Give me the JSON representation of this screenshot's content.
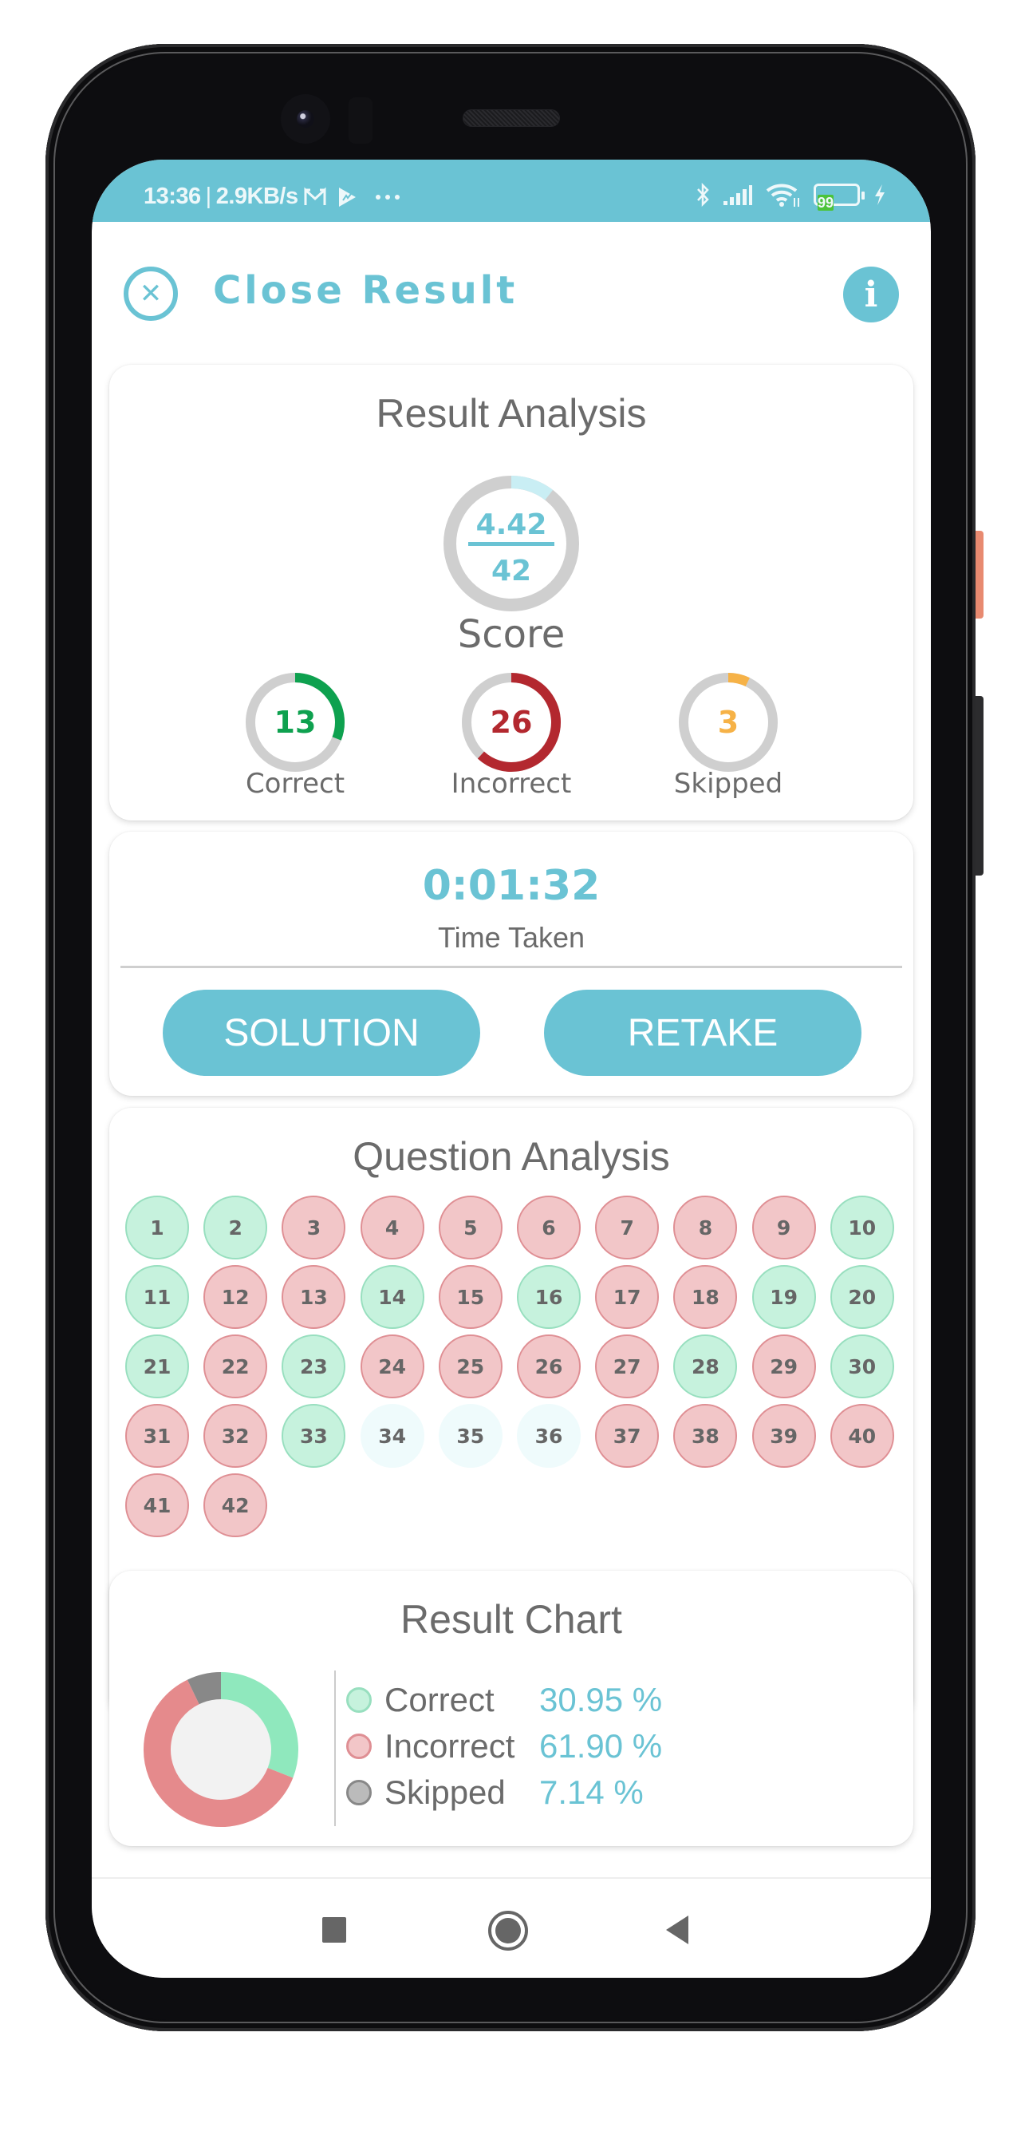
{
  "status_bar": {
    "time": "13:36",
    "separator": "|",
    "network_speed": "2.9KB/s",
    "battery_level": "99",
    "icons": [
      "gmail-icon",
      "play-icon",
      "more-dots-icon",
      "bluetooth-icon",
      "signal-icon",
      "wifi-icon",
      "battery-icon",
      "charging-icon"
    ]
  },
  "header": {
    "close_icon": "close-circle-icon",
    "title": "Close Result",
    "info_icon": "info-icon"
  },
  "colors": {
    "accent": "#6ac3d4",
    "correct": "#0ea14f",
    "incorrect": "#b3282f",
    "skipped": "#f6b247",
    "ring_track": "#cfcfcf",
    "score_arc": "#c9eef4",
    "correct_bg": "#c6f2dd",
    "incorrect_bg": "#f2c6c8",
    "skipped_bg": "#effbfc"
  },
  "result_analysis": {
    "title": "Result Analysis",
    "score": "4.42",
    "max_score": "42",
    "score_fraction": 0.105,
    "score_label": "Score",
    "stats": [
      {
        "key": "correct",
        "value": "13",
        "label": "Correct",
        "fraction": 0.3095
      },
      {
        "key": "incorrect",
        "value": "26",
        "label": "Incorrect",
        "fraction": 0.619
      },
      {
        "key": "skipped",
        "value": "3",
        "label": "Skipped",
        "fraction": 0.0714
      }
    ]
  },
  "time_card": {
    "time_value": "0:01:32",
    "time_label": "Time Taken",
    "solution_label": "SOLUTION",
    "retake_label": "RETAKE"
  },
  "question_analysis": {
    "title": "Question Analysis",
    "questions": [
      {
        "n": "1",
        "s": "correct"
      },
      {
        "n": "2",
        "s": "correct"
      },
      {
        "n": "3",
        "s": "incorrect"
      },
      {
        "n": "4",
        "s": "incorrect"
      },
      {
        "n": "5",
        "s": "incorrect"
      },
      {
        "n": "6",
        "s": "incorrect"
      },
      {
        "n": "7",
        "s": "incorrect"
      },
      {
        "n": "8",
        "s": "incorrect"
      },
      {
        "n": "9",
        "s": "incorrect"
      },
      {
        "n": "10",
        "s": "correct"
      },
      {
        "n": "11",
        "s": "correct"
      },
      {
        "n": "12",
        "s": "incorrect"
      },
      {
        "n": "13",
        "s": "incorrect"
      },
      {
        "n": "14",
        "s": "correct"
      },
      {
        "n": "15",
        "s": "incorrect"
      },
      {
        "n": "16",
        "s": "correct"
      },
      {
        "n": "17",
        "s": "incorrect"
      },
      {
        "n": "18",
        "s": "incorrect"
      },
      {
        "n": "19",
        "s": "correct"
      },
      {
        "n": "20",
        "s": "correct"
      },
      {
        "n": "21",
        "s": "correct"
      },
      {
        "n": "22",
        "s": "incorrect"
      },
      {
        "n": "23",
        "s": "correct"
      },
      {
        "n": "24",
        "s": "incorrect"
      },
      {
        "n": "25",
        "s": "incorrect"
      },
      {
        "n": "26",
        "s": "incorrect"
      },
      {
        "n": "27",
        "s": "incorrect"
      },
      {
        "n": "28",
        "s": "correct"
      },
      {
        "n": "29",
        "s": "incorrect"
      },
      {
        "n": "30",
        "s": "correct"
      },
      {
        "n": "31",
        "s": "incorrect"
      },
      {
        "n": "32",
        "s": "incorrect"
      },
      {
        "n": "33",
        "s": "correct"
      },
      {
        "n": "34",
        "s": "skipped"
      },
      {
        "n": "35",
        "s": "skipped"
      },
      {
        "n": "36",
        "s": "skipped"
      },
      {
        "n": "37",
        "s": "incorrect"
      },
      {
        "n": "38",
        "s": "incorrect"
      },
      {
        "n": "39",
        "s": "incorrect"
      },
      {
        "n": "40",
        "s": "incorrect"
      },
      {
        "n": "41",
        "s": "incorrect"
      },
      {
        "n": "42",
        "s": "incorrect"
      }
    ]
  },
  "result_chart": {
    "title": "Result Chart",
    "legend": [
      {
        "label": "Correct",
        "value": "30.95 %",
        "color": "#8fe8bd",
        "dot_color": "#c6f2dd",
        "dot_border": "#98dfbf"
      },
      {
        "label": "Incorrect",
        "value": "61.90 %",
        "color": "#e58a8c",
        "dot_color": "#f2c6c8",
        "dot_border": "#df8f94"
      },
      {
        "label": "Skipped",
        "value": "7.14 %",
        "color": "#888888",
        "dot_color": "#bbbbbb",
        "dot_border": "#888888"
      }
    ]
  },
  "chart_data": {
    "type": "pie",
    "title": "Result Chart",
    "categories": [
      "Correct",
      "Incorrect",
      "Skipped"
    ],
    "values": [
      30.95,
      61.9,
      7.14
    ],
    "legend_position": "right"
  },
  "nav_bar": {
    "icons": [
      "recent-apps-icon",
      "home-icon",
      "back-icon"
    ]
  }
}
